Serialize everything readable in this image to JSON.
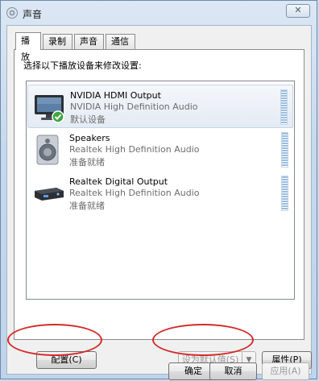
{
  "window": {
    "title": "声音",
    "close_glyph": "✕"
  },
  "tabs": [
    {
      "label": "播放",
      "active": true
    },
    {
      "label": "录制",
      "active": false
    },
    {
      "label": "声音",
      "active": false
    },
    {
      "label": "通信",
      "active": false
    }
  ],
  "instruction": "选择以下播放设备来修改设置:",
  "devices": [
    {
      "name": "NVIDIA HDMI Output",
      "driver": "NVIDIA High Definition Audio",
      "status": "默认设备",
      "icon": "monitor-icon",
      "selected": true,
      "is_default": true
    },
    {
      "name": "Speakers",
      "driver": "Realtek High Definition Audio",
      "status": "准备就绪",
      "icon": "speaker-icon",
      "selected": false,
      "is_default": false
    },
    {
      "name": "Realtek Digital Output",
      "driver": "Realtek High Definition Audio",
      "status": "准备就绪",
      "icon": "digital-output-icon",
      "selected": false,
      "is_default": false
    }
  ],
  "buttons": {
    "configure": "配置(C)",
    "set_default": "设为默认值(S)",
    "properties": "属性(P)",
    "ok": "确定",
    "cancel": "取消",
    "apply": "应用(A)"
  },
  "colors": {
    "annotation_red": "#d42a2a",
    "level_blue": "#9bbde0"
  }
}
